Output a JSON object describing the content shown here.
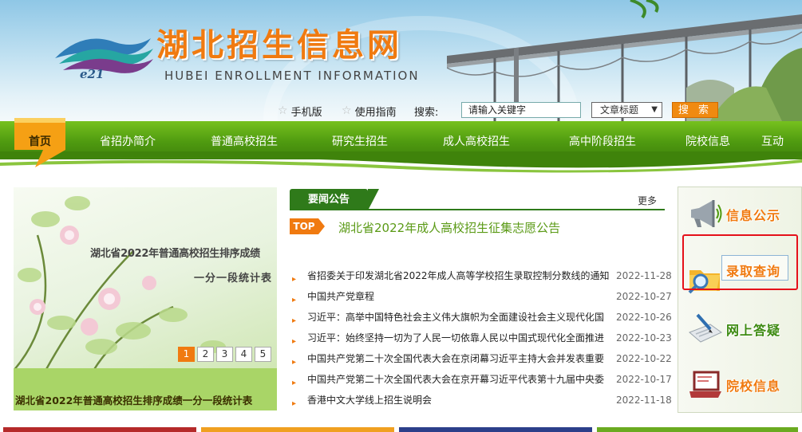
{
  "header": {
    "logo_text": "e21",
    "title": "湖北招生信息网",
    "subtitle": "HUBEI ENROLLMENT INFORMATION"
  },
  "toolbar": {
    "mobile_label": "手机版",
    "guide_label": "使用指南",
    "search_label": "搜索:",
    "search_placeholder": "请输入关键字",
    "search_type_selected": "文章标题",
    "search_button": "搜 索"
  },
  "nav": {
    "home": "首页",
    "items": [
      "省招办简介",
      "普通高校招生",
      "研究生招生",
      "成人高校招生",
      "高中阶段招生",
      "院校信息",
      "互动"
    ]
  },
  "carousel": {
    "line1": "湖北省2022年普通高校招生排序成绩",
    "line2": "一分一段统计表",
    "pages": [
      "1",
      "2",
      "3",
      "4",
      "5"
    ],
    "active_page": "1",
    "caption": "湖北省2022年普通高校招生排序成绩一分一段统计表"
  },
  "news": {
    "tab_label": "要闻公告",
    "more_label": "更多",
    "top_badge": "TOP",
    "top_title": "湖北省2022年成人高校招生征集志愿公告",
    "items": [
      {
        "title": "省招委关于印发湖北省2022年成人高等学校招生录取控制分数线的通知",
        "date": "2022-11-28"
      },
      {
        "title": "中国共产党章程",
        "date": "2022-10-27"
      },
      {
        "title": "习近平：高举中国特色社会主义伟大旗帜为全面建设社会主义现代化国",
        "date": "2022-10-26"
      },
      {
        "title": "习近平：始终坚持一切为了人民一切依靠人民以中国式现代化全面推进",
        "date": "2022-10-23"
      },
      {
        "title": "中国共产党第二十次全国代表大会在京闭幕习近平主持大会并发表重要",
        "date": "2022-10-22"
      },
      {
        "title": "中国共产党第二十次全国代表大会在京开幕习近平代表第十九届中央委",
        "date": "2022-10-17"
      },
      {
        "title": "香港中文大学线上招生说明会",
        "date": "2022-11-18"
      }
    ]
  },
  "side": {
    "items": [
      {
        "label": "信息公示",
        "icon": "megaphone-icon"
      },
      {
        "label": "录取查询",
        "icon": "folder-search-icon"
      },
      {
        "label": "网上答疑",
        "icon": "pen-document-icon"
      },
      {
        "label": "院校信息",
        "icon": "laptop-icon"
      }
    ]
  },
  "colors": {
    "accent_orange": "#f07a10",
    "nav_green": "#4f9a10",
    "highlight_red": "#e5101a"
  }
}
